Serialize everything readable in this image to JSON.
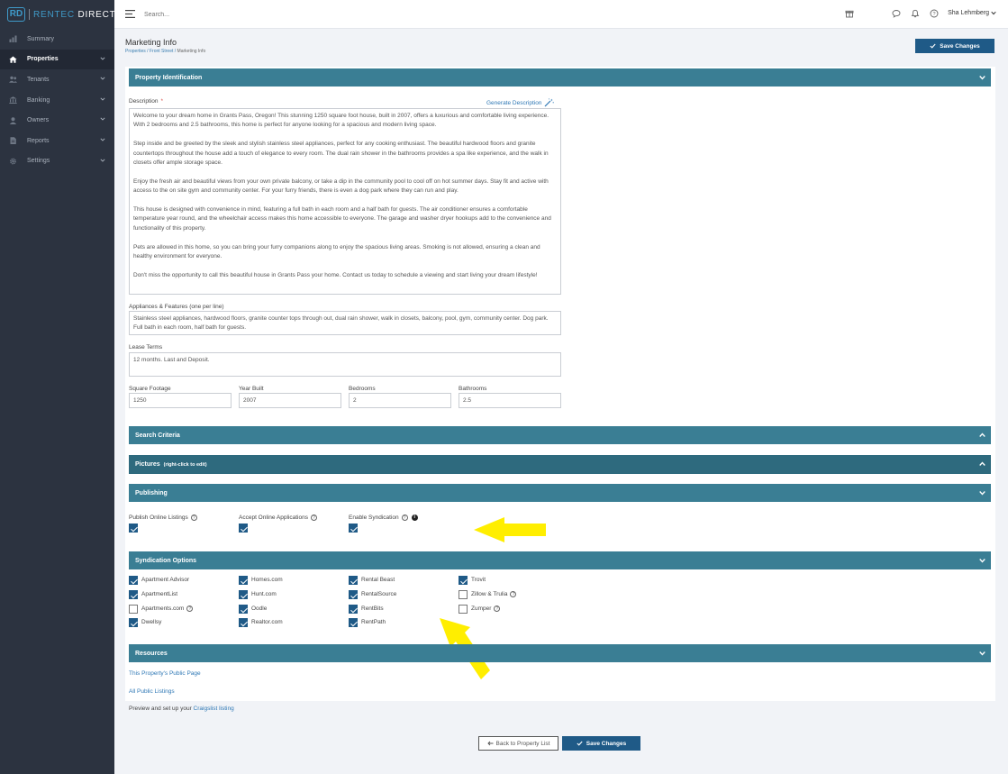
{
  "brand": {
    "mark": "RD",
    "name_a": "RENTEC",
    "name_b": " DIRECT"
  },
  "nav": [
    {
      "label": "Summary",
      "icon": "chart-icon",
      "active": false,
      "chevron": false
    },
    {
      "label": "Properties",
      "icon": "home-icon",
      "active": true,
      "chevron": true
    },
    {
      "label": "Tenants",
      "icon": "users-icon",
      "active": false,
      "chevron": true
    },
    {
      "label": "Banking",
      "icon": "bank-icon",
      "active": false,
      "chevron": true
    },
    {
      "label": "Owners",
      "icon": "user-icon",
      "active": false,
      "chevron": true
    },
    {
      "label": "Reports",
      "icon": "document-icon",
      "active": false,
      "chevron": true
    },
    {
      "label": "Settings",
      "icon": "gear-icon",
      "active": false,
      "chevron": true
    }
  ],
  "topbar": {
    "search_placeholder": "Search...",
    "user_name": "Sha Lehmberg"
  },
  "page": {
    "title": "Marketing Info",
    "breadcrumb": [
      "Properties",
      "Front Street",
      "Marketing Info"
    ],
    "save_label": "Save Changes",
    "back_label": "Back to Property List"
  },
  "sections": {
    "property_identification": "Property Identification",
    "search_criteria": "Search Criteria",
    "pictures": "Pictures",
    "pictures_note": "(right-click to edit)",
    "publishing": "Publishing",
    "syndication_options": "Syndication Options",
    "resources": "Resources"
  },
  "description": {
    "label": "Description",
    "required_mark": "*",
    "generate_label": "Generate Description",
    "paragraphs": [
      "Welcome to your dream home in Grants Pass, Oregon! This stunning 1250 square foot house, built in 2007, offers a luxurious and comfortable living experience. With 2 bedrooms and 2.5 bathrooms, this home is perfect for anyone looking for a spacious and modern living space.",
      "Step inside and be greeted by the sleek and stylish stainless steel appliances, perfect for any cooking enthusiast. The beautiful hardwood floors and granite countertops throughout the house add a touch of elegance to every room. The dual rain shower in the bathrooms provides a spa like experience, and the walk in closets offer ample storage space.",
      "Enjoy the fresh air and beautiful views from your own private balcony, or take a dip in the community pool to cool off on hot summer days. Stay fit and active with access to the on site gym and community center. For your furry friends, there is even a dog park where they can run and play.",
      "This house is designed with convenience in mind, featuring a full bath in each room and a half bath for guests. The air conditioner ensures a comfortable temperature year round, and the wheelchair access makes this home accessible to everyone. The garage and washer dryer hookups add to the convenience and functionality of this property.",
      "Pets are allowed in this home, so you can bring your furry companions along to enjoy the spacious living areas. Smoking is not allowed, ensuring a clean and healthy environment for everyone.",
      "Don't miss the opportunity to call this beautiful house in Grants Pass your home. Contact us today to schedule a viewing and start living your dream lifestyle!"
    ]
  },
  "appliances": {
    "label": "Appliances & Features  (one per line)",
    "value": "Stainless steel appliances, hardwood floors, granite counter tops through out, dual rain shower, walk in closets, balcony, pool, gym, community center. Dog park. Full bath in each room, half bath for guests."
  },
  "lease": {
    "label": "Lease Terms",
    "value": "12 months. Last and Deposit."
  },
  "fields": [
    {
      "label": "Square Footage",
      "value": "1250"
    },
    {
      "label": "Year Built",
      "value": "2007"
    },
    {
      "label": "Bedrooms",
      "value": "2"
    },
    {
      "label": "Bathrooms",
      "value": "2.5"
    }
  ],
  "publishing": [
    {
      "label": "Publish Online Listings",
      "checked": true,
      "help": true,
      "info": false
    },
    {
      "label": "Accept Online Applications",
      "checked": true,
      "help": true,
      "info": false
    },
    {
      "label": "Enable Syndication",
      "checked": true,
      "help": true,
      "info": true
    }
  ],
  "syndication": [
    [
      {
        "label": "Apartment Advisor",
        "checked": true,
        "help": false
      },
      {
        "label": "ApartmentList",
        "checked": true,
        "help": false
      },
      {
        "label": "Apartments.com",
        "checked": false,
        "help": true
      },
      {
        "label": "Dwellsy",
        "checked": true,
        "help": false
      }
    ],
    [
      {
        "label": "Homes.com",
        "checked": true,
        "help": false
      },
      {
        "label": "Hunt.com",
        "checked": true,
        "help": false
      },
      {
        "label": "Oodle",
        "checked": true,
        "help": false
      },
      {
        "label": "Realtor.com",
        "checked": true,
        "help": false
      }
    ],
    [
      {
        "label": "Rental Beast",
        "checked": true,
        "help": false
      },
      {
        "label": "RentalSource",
        "checked": true,
        "help": false
      },
      {
        "label": "RentBits",
        "checked": true,
        "help": false
      },
      {
        "label": "RentPath",
        "checked": true,
        "help": false
      }
    ],
    [
      {
        "label": "Trovit",
        "checked": true,
        "help": false
      },
      {
        "label": "Zillow & Trulia",
        "checked": false,
        "help": true
      },
      {
        "label": "Zumper",
        "checked": false,
        "help": true
      }
    ]
  ],
  "resources": {
    "public_page": "This Property's Public Page",
    "all_listings": "All Public Listings",
    "craigslist_prefix": "Preview and set up your ",
    "craigslist_link": "Craigslist listing"
  },
  "colors": {
    "sidebar": "#2c3340",
    "section_header": "#3a7e94",
    "primary_button": "#1f5a87",
    "link": "#2f78b5",
    "annotation_arrow": "#ffee00"
  }
}
